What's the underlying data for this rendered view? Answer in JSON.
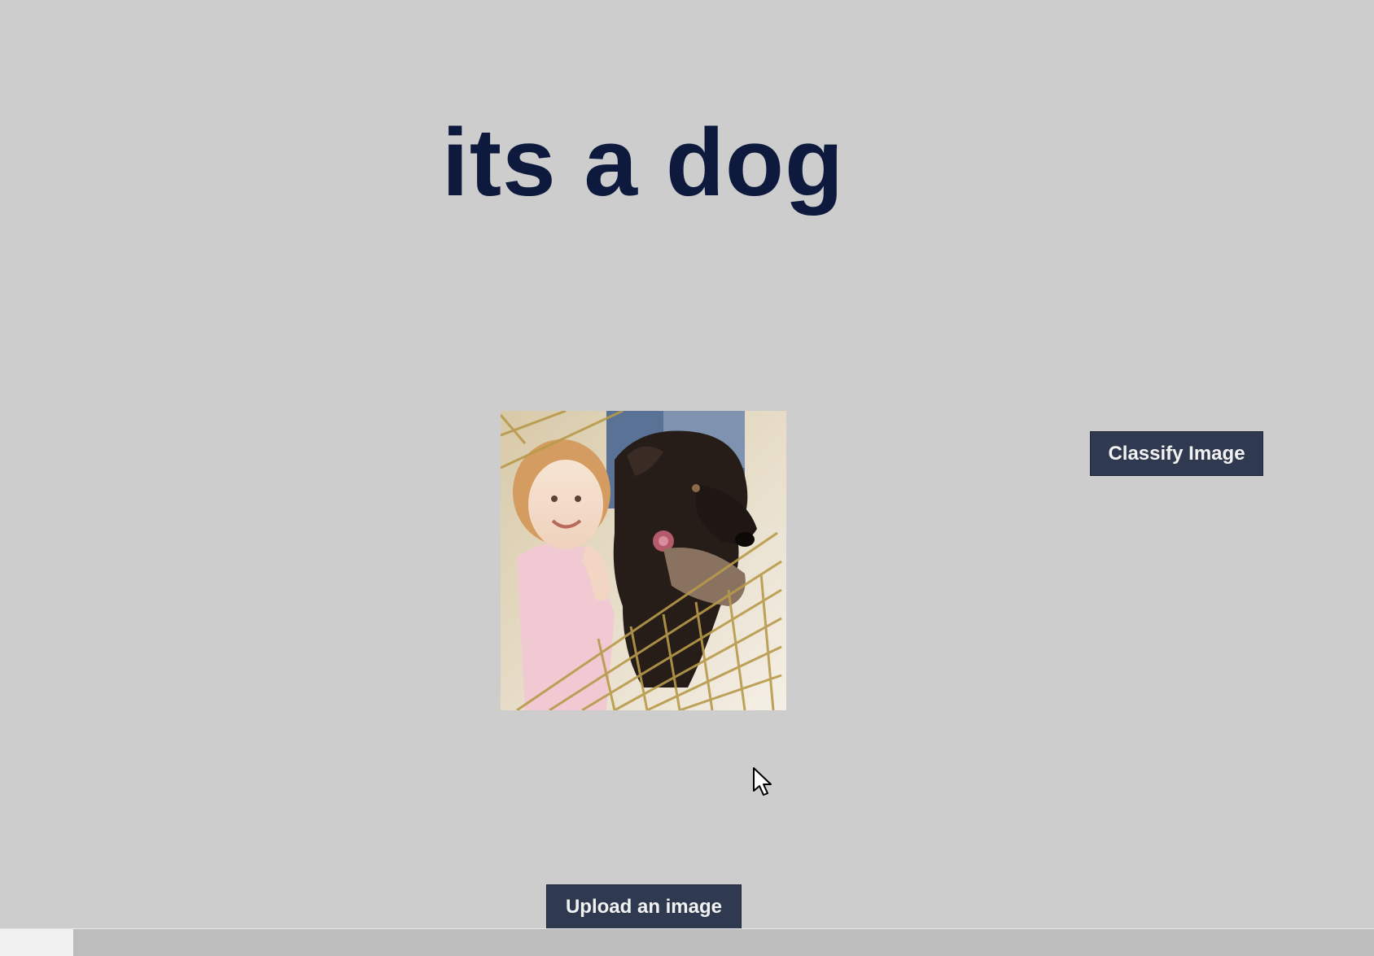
{
  "result": {
    "heading": "its a dog"
  },
  "preview": {
    "image_name": "uploaded-image-preview"
  },
  "actions": {
    "classify_label": "Classify Image",
    "upload_label": "Upload an image"
  },
  "colors": {
    "background": "#cdcdcd",
    "heading": "#0d1a3d",
    "button_bg": "#2f3a50",
    "button_text": "#f2f2f2"
  }
}
